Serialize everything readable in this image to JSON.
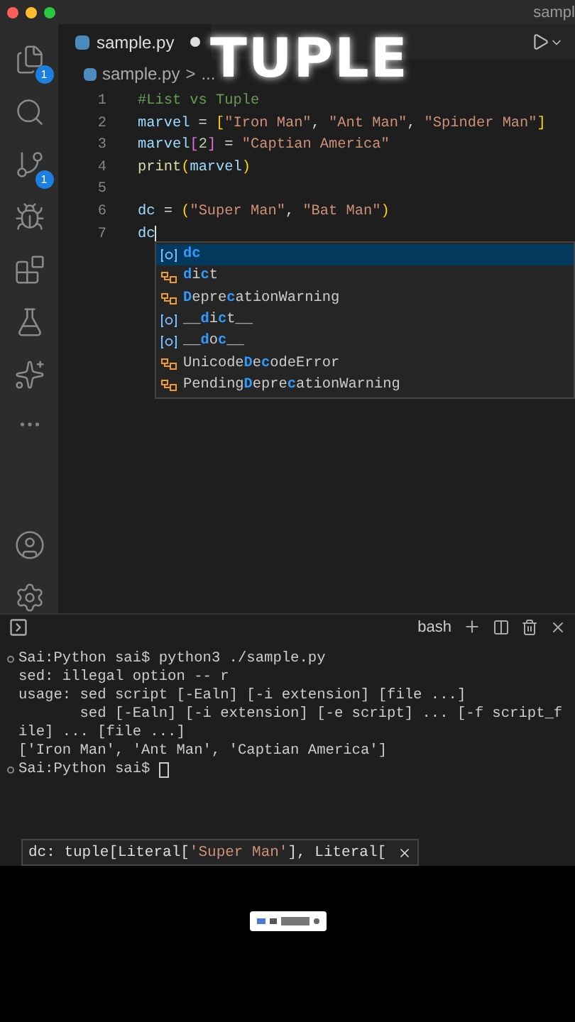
{
  "window": {
    "title": "sampl"
  },
  "overlay_title": "TUPLE",
  "activity_bar": [
    {
      "kind": "files",
      "badge": "1"
    },
    {
      "kind": "search"
    },
    {
      "kind": "source-control",
      "badge": "1"
    },
    {
      "kind": "debug"
    },
    {
      "kind": "extensions"
    },
    {
      "kind": "flask"
    },
    {
      "kind": "chat"
    },
    {
      "kind": "more"
    },
    {
      "kind": "account"
    },
    {
      "kind": "settings"
    }
  ],
  "tab": {
    "label": "sample.py",
    "modified": true
  },
  "breadcrumb": {
    "file": "sample.py",
    "separator": ">",
    "rest": "..."
  },
  "code": [
    {
      "number": "1",
      "tokens": [
        {
          "kind": "comment",
          "text": "#List vs Tuple"
        }
      ]
    },
    {
      "number": "2",
      "tokens": [
        {
          "kind": "var",
          "text": "marvel"
        },
        {
          "kind": "op",
          "text": " = "
        },
        {
          "kind": "bracket",
          "text": "["
        },
        {
          "kind": "string",
          "text": "\"Iron Man\""
        },
        {
          "kind": "op",
          "text": ", "
        },
        {
          "kind": "string",
          "text": "\"Ant Man\""
        },
        {
          "kind": "op",
          "text": ", "
        },
        {
          "kind": "string",
          "text": "\"Spinder Man\""
        },
        {
          "kind": "bracket",
          "text": "]"
        }
      ]
    },
    {
      "number": "3",
      "tokens": [
        {
          "kind": "var",
          "text": "marvel"
        },
        {
          "kind": "bracket2",
          "text": "["
        },
        {
          "kind": "number",
          "text": "2"
        },
        {
          "kind": "bracket2",
          "text": "]"
        },
        {
          "kind": "op",
          "text": " = "
        },
        {
          "kind": "string",
          "text": "\"Captian America\""
        }
      ]
    },
    {
      "number": "4",
      "tokens": [
        {
          "kind": "func",
          "text": "print"
        },
        {
          "kind": "bracket",
          "text": "("
        },
        {
          "kind": "var",
          "text": "marvel"
        },
        {
          "kind": "bracket",
          "text": ")"
        }
      ]
    },
    {
      "number": "5"
    },
    {
      "number": "6",
      "tokens": [
        {
          "kind": "var",
          "text": "dc"
        },
        {
          "kind": "op",
          "text": " = "
        },
        {
          "kind": "bracket",
          "text": "("
        },
        {
          "kind": "string",
          "text": "\"Super Man\""
        },
        {
          "kind": "op",
          "text": ", "
        },
        {
          "kind": "string",
          "text": "\"Bat Man\""
        },
        {
          "kind": "bracket",
          "text": ")"
        }
      ]
    },
    {
      "number": "7",
      "tokens": [
        {
          "kind": "var",
          "text": "dc"
        }
      ],
      "cursor": true
    }
  ],
  "suggestions": [
    {
      "kind": "variable",
      "label": "**dc**",
      "selected": true
    },
    {
      "kind": "class",
      "label": "**d**i**c**t",
      "selected": false
    },
    {
      "kind": "class",
      "label": "**D**epre**c**ationWarning",
      "selected": false
    },
    {
      "kind": "variable",
      "label": "__**d**i**c**t__",
      "selected": false
    },
    {
      "kind": "variable",
      "label": "__**d**o**c**__",
      "selected": false
    },
    {
      "kind": "class",
      "label": "Unicode**D**e**c**odeError",
      "selected": false
    },
    {
      "kind": "class",
      "label": "Pending**D**epre**c**ationWarning",
      "selected": false
    }
  ],
  "panel": {
    "shell": "bash"
  },
  "terminal": [
    {
      "kind": "prompt",
      "text": "Sai:Python sai$ python3 ./sample.py"
    },
    {
      "kind": "output",
      "text": "sed: illegal option -- r"
    },
    {
      "kind": "output",
      "text": "usage: sed script [-Ealn] [-i extension] [file ...]"
    },
    {
      "kind": "output",
      "text": "       sed [-Ealn] [-i extension] [-e script] ... [-f script_f"
    },
    {
      "kind": "output",
      "text": "ile] ... [file ...]"
    },
    {
      "kind": "output",
      "text": "['Iron Man', 'Ant Man', 'Captian America']"
    },
    {
      "kind": "prompt",
      "text": "Sai:Python sai$ ",
      "cursor": true
    }
  ],
  "hover": [
    {
      "kind": "type",
      "text": "dc: tuple[Literal["
    },
    {
      "kind": "string",
      "text": "'Super Man'"
    },
    {
      "kind": "type",
      "text": "], Literal["
    }
  ]
}
